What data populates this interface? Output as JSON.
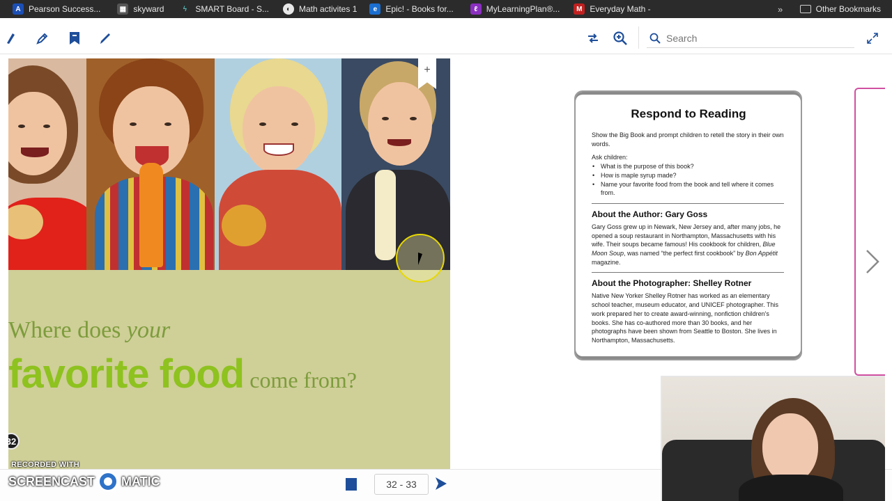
{
  "browser": {
    "bookmarks": [
      {
        "label": "Pearson Success...",
        "icon": "pearson-icon",
        "color": "#1b4fb5"
      },
      {
        "label": "skyward",
        "icon": "skyward-icon",
        "color": "#444444"
      },
      {
        "label": "SMART Board - S...",
        "icon": "smart-icon",
        "color": "#2a6f6f"
      },
      {
        "label": "Math activites 1",
        "icon": "globe-icon",
        "color": "#555555"
      },
      {
        "label": "Epic! - Books for...",
        "icon": "epic-icon",
        "color": "#1b6fd0"
      },
      {
        "label": "MyLearningPlan®...",
        "icon": "mlp-icon",
        "color": "#8a2fbf"
      },
      {
        "label": "Everyday Math -",
        "icon": "mcgraw-icon",
        "color": "#c02020"
      }
    ],
    "more_label": "»",
    "other_bookmarks": "Other Bookmarks"
  },
  "toolbar": {
    "search_placeholder": "Search"
  },
  "left_page": {
    "headline_line1_prefix": "Where does ",
    "headline_line1_em": "your",
    "headline_big": "favorite food",
    "headline_small": "come from?",
    "page_badge": "32",
    "bookmark_plus": "+"
  },
  "card": {
    "title": "Respond to Reading",
    "intro": "Show the Big Book and prompt children to retell the story in their own words.",
    "ask_label": "Ask children:",
    "questions": [
      "What is the purpose of this book?",
      "How is maple syrup made?",
      "Name your favorite food from the book and tell where it comes from."
    ],
    "author_heading": "About the Author: Gary Goss",
    "author_text_1": "Gary Goss grew up in Newark, New Jersey and, after many jobs, he opened a soup restaurant in Northampton, Massachusetts with his wife. Their soups became famous! His cookbook for children, ",
    "author_book": "Blue Moon Soup",
    "author_text_2": ", was named “the perfect first cookbook” by ",
    "author_mag": "Bon Appétit",
    "author_text_3": " magazine.",
    "photographer_heading": "About the Photographer: Shelley Rotner",
    "photographer_text": "Native New Yorker Shelley Rotner has worked as an elementary school teacher, museum educator, and UNICEF photographer. This work prepared her to create award-winning, nonfiction children's books. She has co-authored more than 30 books, and her photographs have been shown from Seattle to Boston. She lives in Northampton, Massachusetts."
  },
  "bottom_nav": {
    "page_range": "32 - 33"
  },
  "watermark": {
    "recorded_with": "RECORDED WITH",
    "brand_left": "SCREENCAST",
    "brand_right": "MATIC"
  }
}
